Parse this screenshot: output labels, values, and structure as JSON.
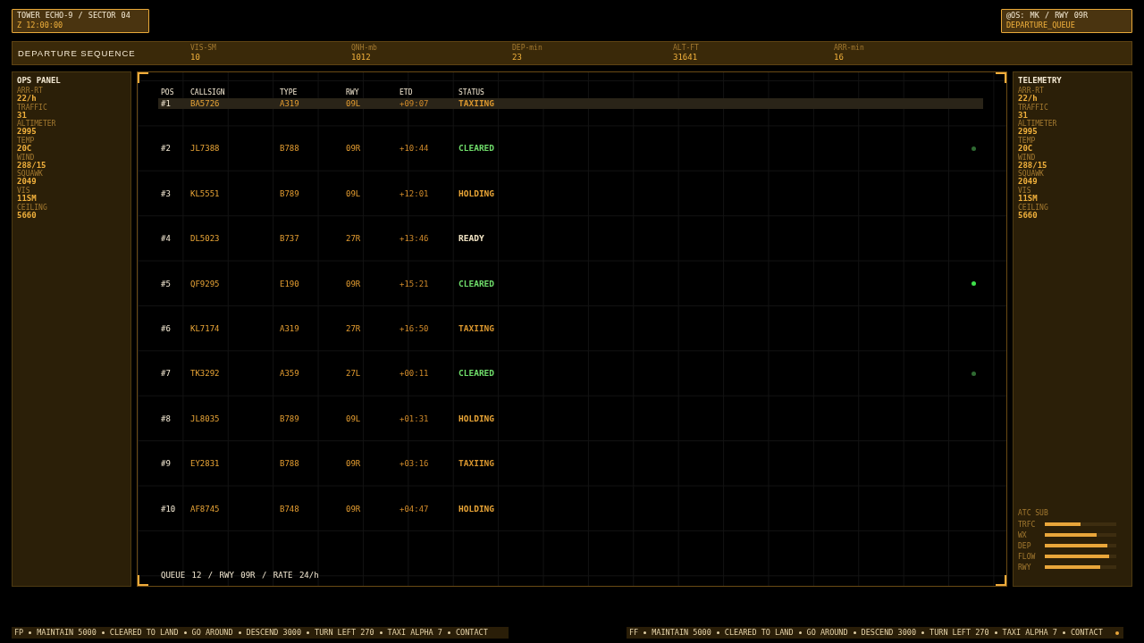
{
  "header": {
    "station": "TOWER ECHO-9 / SECTOR 04",
    "clock": "Z 12:00:00"
  },
  "operator": {
    "line": "@OS: MK / RWY 09R",
    "mode": "DEPARTURE_QUEUE"
  },
  "status_bar": {
    "title": "DEPARTURE SEQUENCE",
    "stats": [
      {
        "label": "VIS-SM",
        "value": "10"
      },
      {
        "label": "QNH-mb",
        "value": "1012"
      },
      {
        "label": "DEP-min",
        "value": "23"
      },
      {
        "label": "ALT-FT",
        "value": "31641"
      },
      {
        "label": "ARR-min",
        "value": "16"
      }
    ]
  },
  "ops_panel": {
    "title": "OPS PANEL",
    "readouts": [
      {
        "label": "ARR-RT",
        "value": "22/h"
      },
      {
        "label": "TRAFFIC",
        "value": "31"
      },
      {
        "label": "ALTIMETER",
        "value": "2995"
      },
      {
        "label": "TEMP",
        "value": "20C"
      },
      {
        "label": "WIND",
        "value": "288/15"
      },
      {
        "label": "SQUAWK",
        "value": "2049"
      },
      {
        "label": "VIS",
        "value": "11SM"
      },
      {
        "label": "CEILING",
        "value": "5660"
      }
    ]
  },
  "table": {
    "columns": [
      "POS",
      "CALLSIGN",
      "TYPE",
      "RWY",
      "ETD",
      "STATUS"
    ],
    "rows": [
      {
        "pos": "#1",
        "callsign": "BA5726",
        "type": "A319",
        "rwy": "09L",
        "etd": "+09:07",
        "status": "TAXIING",
        "kind": "taxiing",
        "selected": true
      },
      {
        "pos": "#2",
        "callsign": "JL7388",
        "type": "B788",
        "rwy": "09R",
        "etd": "+10:44",
        "status": "CLEARED",
        "kind": "cleared",
        "selected": false,
        "marker": {
          "color": "#2f6a32"
        }
      },
      {
        "pos": "#3",
        "callsign": "KL5551",
        "type": "B789",
        "rwy": "09L",
        "etd": "+12:01",
        "status": "HOLDING",
        "kind": "holding",
        "selected": false
      },
      {
        "pos": "#4",
        "callsign": "DL5023",
        "type": "B737",
        "rwy": "27R",
        "etd": "+13:46",
        "status": "READY",
        "kind": "ready",
        "selected": false
      },
      {
        "pos": "#5",
        "callsign": "QF9295",
        "type": "E190",
        "rwy": "09R",
        "etd": "+15:21",
        "status": "CLEARED",
        "kind": "cleared",
        "selected": false,
        "marker": {
          "color": "#3ee04a"
        }
      },
      {
        "pos": "#6",
        "callsign": "KL7174",
        "type": "A319",
        "rwy": "27R",
        "etd": "+16:50",
        "status": "TAXIING",
        "kind": "taxiing",
        "selected": false
      },
      {
        "pos": "#7",
        "callsign": "TK3292",
        "type": "A359",
        "rwy": "27L",
        "etd": "+00:11",
        "status": "CLEARED",
        "kind": "cleared",
        "selected": false,
        "marker": {
          "color": "#2f6a32"
        }
      },
      {
        "pos": "#8",
        "callsign": "JL8035",
        "type": "B789",
        "rwy": "09L",
        "etd": "+01:31",
        "status": "HOLDING",
        "kind": "holding",
        "selected": false
      },
      {
        "pos": "#9",
        "callsign": "EY2831",
        "type": "B788",
        "rwy": "09R",
        "etd": "+03:16",
        "status": "TAXIING",
        "kind": "taxiing",
        "selected": false
      },
      {
        "pos": "#10",
        "callsign": "AF8745",
        "type": "B748",
        "rwy": "09R",
        "etd": "+04:47",
        "status": "HOLDING",
        "kind": "holding",
        "selected": false
      }
    ],
    "footer": "QUEUE 12 / RWY 09R / RATE 24/h"
  },
  "telemetry": {
    "title": "TELEMETRY",
    "readouts": [
      {
        "label": "ARR-RT",
        "value": "22/h"
      },
      {
        "label": "TRAFFIC",
        "value": "31"
      },
      {
        "label": "ALTIMETER",
        "value": "2995"
      },
      {
        "label": "TEMP",
        "value": "20C"
      },
      {
        "label": "WIND",
        "value": "288/15"
      },
      {
        "label": "SQUAWK",
        "value": "2049"
      },
      {
        "label": "VIS",
        "value": "11SM"
      },
      {
        "label": "CEILING",
        "value": "5660"
      }
    ],
    "meters": {
      "title": "ATC SUB",
      "items": [
        {
          "label": "TRFC",
          "level": 0.5
        },
        {
          "label": "WX",
          "level": 0.73
        },
        {
          "label": "DEP",
          "level": 0.88
        },
        {
          "label": "FLOW",
          "level": 0.9
        },
        {
          "label": "RWY",
          "level": 0.78
        }
      ]
    }
  },
  "tickers": [
    {
      "items": [
        "FP",
        "MAINTAIN 5000",
        "CLEARED TO LAND",
        "GO AROUND",
        "DESCEND 3000",
        "TURN LEFT 270",
        "TAXI ALPHA 7",
        "CONTACT"
      ],
      "trailing_bullet": false
    },
    {
      "items": [
        "FF",
        "MAINTAIN 5000",
        "CLEARED TO LAND",
        "GO AROUND",
        "DESCEND 3000",
        "TURN LEFT 270",
        "TAXI ALPHA 7",
        "CONTACT"
      ],
      "trailing_bullet": true
    }
  ]
}
